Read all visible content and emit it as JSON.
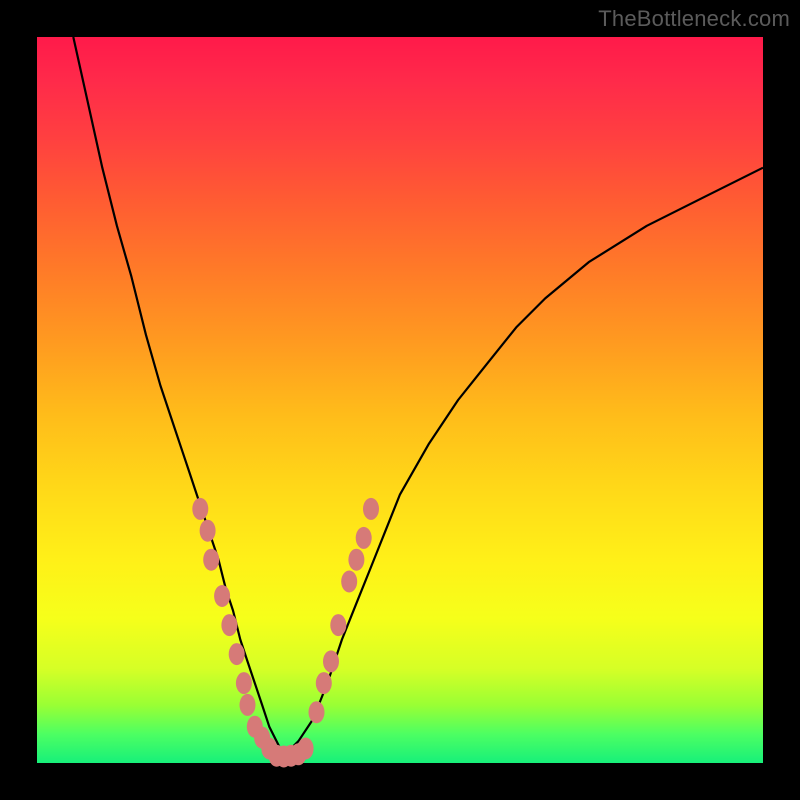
{
  "watermark": "TheBottleneck.com",
  "colors": {
    "background": "#000000",
    "marker": "#d67a78",
    "curve": "#000000",
    "gradient_top": "#ff1a4a",
    "gradient_bottom": "#17f07a"
  },
  "chart_data": {
    "type": "line",
    "title": "",
    "xlabel": "",
    "ylabel": "",
    "xlim": [
      0,
      100
    ],
    "ylim": [
      0,
      100
    ],
    "grid": false,
    "legend": false,
    "curve_left": {
      "x": [
        5,
        7,
        9,
        11,
        13,
        15,
        17,
        19,
        20,
        21,
        22,
        23,
        24,
        25,
        26,
        27,
        28,
        29,
        30,
        31,
        32,
        33,
        34
      ],
      "y": [
        100,
        91,
        82,
        74,
        67,
        59,
        52,
        46,
        43,
        40,
        37,
        34,
        31,
        28,
        24,
        21,
        17,
        14,
        11,
        8,
        5,
        3,
        1
      ]
    },
    "curve_right": {
      "x": [
        34,
        36,
        38,
        40,
        42,
        44,
        46,
        48,
        50,
        54,
        58,
        62,
        66,
        70,
        76,
        84,
        92,
        100
      ],
      "y": [
        1,
        3,
        6,
        11,
        17,
        22,
        27,
        32,
        37,
        44,
        50,
        55,
        60,
        64,
        69,
        74,
        78,
        82
      ]
    },
    "markers": [
      {
        "x": 22.5,
        "y": 35
      },
      {
        "x": 23.5,
        "y": 32
      },
      {
        "x": 24,
        "y": 28
      },
      {
        "x": 25.5,
        "y": 23
      },
      {
        "x": 26.5,
        "y": 19
      },
      {
        "x": 27.5,
        "y": 15
      },
      {
        "x": 28.5,
        "y": 11
      },
      {
        "x": 29,
        "y": 8
      },
      {
        "x": 30,
        "y": 5
      },
      {
        "x": 31,
        "y": 3.5
      },
      {
        "x": 32,
        "y": 2
      },
      {
        "x": 33,
        "y": 1
      },
      {
        "x": 34,
        "y": 0.9
      },
      {
        "x": 35,
        "y": 1
      },
      {
        "x": 36,
        "y": 1.2
      },
      {
        "x": 37,
        "y": 2
      },
      {
        "x": 38.5,
        "y": 7
      },
      {
        "x": 39.5,
        "y": 11
      },
      {
        "x": 40.5,
        "y": 14
      },
      {
        "x": 41.5,
        "y": 19
      },
      {
        "x": 43,
        "y": 25
      },
      {
        "x": 44,
        "y": 28
      },
      {
        "x": 45,
        "y": 31
      },
      {
        "x": 46,
        "y": 35
      }
    ]
  }
}
